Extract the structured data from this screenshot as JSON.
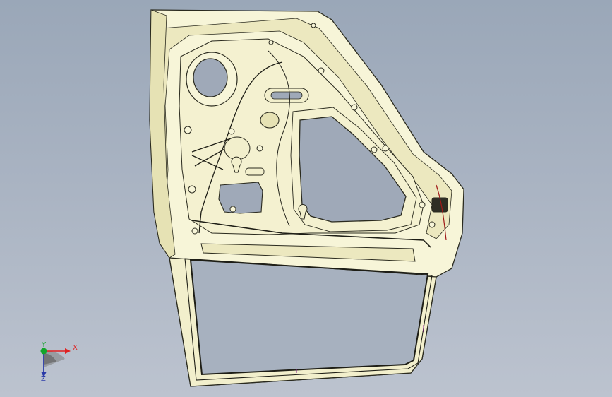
{
  "app": {
    "view": "model-viewport",
    "background_top": "#9aa7b8",
    "background_bottom": "#bcc3cf"
  },
  "model": {
    "part_fill": "#f7f5d8",
    "edge_color": "#2a2a1e",
    "shadow_fill": "#e6e2b4",
    "accent_line": "#a01818"
  },
  "triad": {
    "x_label": "X",
    "y_label": "Y",
    "z_label": "Z",
    "x_color": "#e02020",
    "y_color": "#13a52a",
    "z_color": "#2a3aa8"
  }
}
